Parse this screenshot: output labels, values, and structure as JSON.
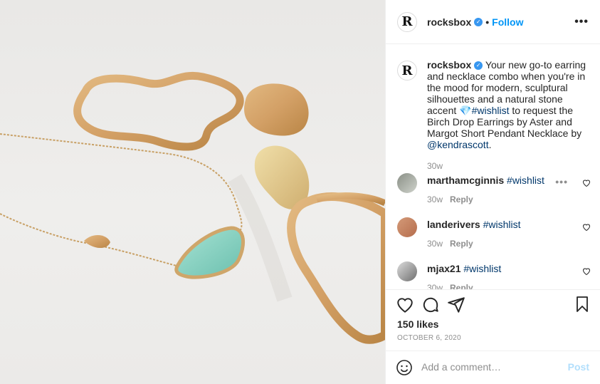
{
  "photo": {
    "alt_icon": "jewelry-photo"
  },
  "header": {
    "avatar_letter": "R",
    "username": "rocksbox",
    "separator": "•",
    "follow_label": "Follow",
    "more_label": "•••"
  },
  "caption": {
    "avatar_letter": "R",
    "username": "rocksbox",
    "text_before_gem": " Your new go-to earring and necklace combo when you're in the mood for modern, sculptural silhouettes and a natural stone accent ",
    "gem": "💎",
    "hashtag": "#wishlist",
    "text_middle": " to request the Birch Drop Earrings by Aster and Margot Short Pendant Necklace by ",
    "mention": "@kendrascott",
    "text_end": ".",
    "time": "30w"
  },
  "comments": [
    {
      "username": "marthamcginnis",
      "text": "#wishlist",
      "time": "30w",
      "reply": "Reply",
      "dots": "•••"
    },
    {
      "username": "landerivers",
      "text": "#wishlist",
      "time": "30w",
      "reply": "Reply"
    },
    {
      "username": "mjax21",
      "text": "#wishlist",
      "time": "30w",
      "reply": "Reply"
    }
  ],
  "actions": {
    "likes": "150 likes",
    "date": "OCTOBER 6, 2020"
  },
  "add_comment": {
    "placeholder": "Add a comment…",
    "post_label": "Post"
  },
  "colors": {
    "accent": "#0095f6",
    "verified": "#3897f0",
    "link": "#00376b",
    "muted": "#8e8e8e"
  }
}
